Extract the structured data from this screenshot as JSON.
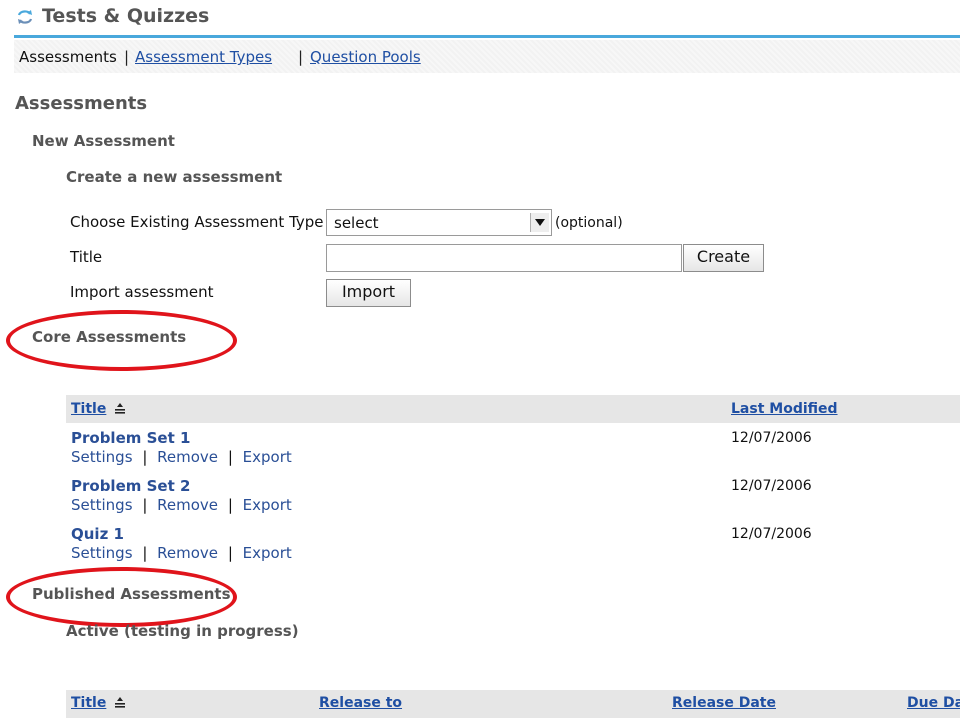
{
  "tool": {
    "title": "Tests & Quizzes",
    "icon": "refresh-arrows-icon",
    "accent_color": "#49a8dc"
  },
  "nav": {
    "current": "Assessments",
    "separator": "|",
    "items": [
      {
        "label": "Assessment Types"
      },
      {
        "label": "Question Pools"
      }
    ]
  },
  "page_title": "Assessments",
  "new_assessment": {
    "heading": "New Assessment",
    "subheading": "Create a new assessment",
    "type_label": "Choose Existing Assessment Type",
    "type_select_value": "select",
    "type_optional_note": "(optional)",
    "title_label": "Title",
    "title_value": "",
    "create_button": "Create",
    "import_label": "Import assessment",
    "import_button": "Import"
  },
  "core": {
    "heading": "Core Assessments",
    "columns": {
      "title": "Title",
      "last_modified": "Last Modified"
    },
    "rows": [
      {
        "title": "Problem Set 1",
        "date": "12/07/2006"
      },
      {
        "title": "Problem Set 2",
        "date": "12/07/2006"
      },
      {
        "title": "Quiz 1",
        "date": "12/07/2006"
      }
    ],
    "actions": {
      "settings": "Settings",
      "remove": "Remove",
      "export": "Export",
      "separator": "|"
    }
  },
  "published": {
    "heading": "Published Assessments",
    "subheading": "Active (testing in progress)",
    "columns": {
      "title": "Title",
      "release_to": "Release to",
      "release_date": "Release Date",
      "due_date": "Due Date"
    }
  },
  "highlight_color": "#e0141b"
}
